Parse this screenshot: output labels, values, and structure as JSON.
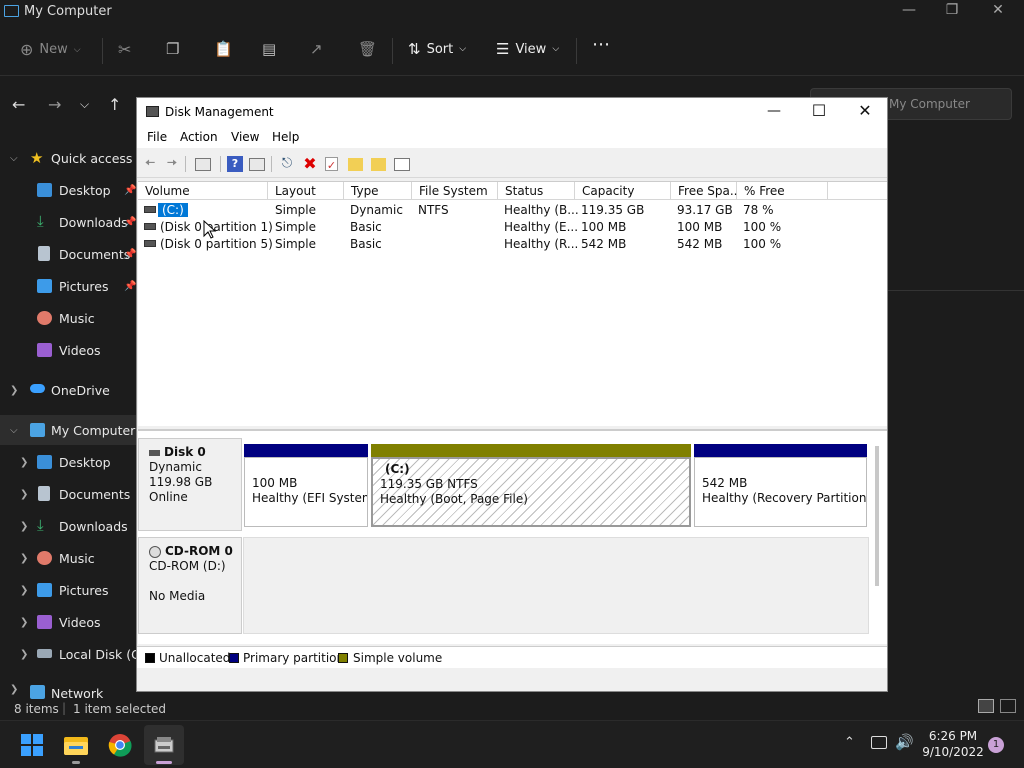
{
  "explorer": {
    "title": "My Computer",
    "commands": {
      "new": "New",
      "sort": "Sort",
      "view": "View"
    },
    "search_placeholder": "My Computer",
    "sidebar": [
      {
        "label": "Quick access",
        "icon": "star-icon"
      },
      {
        "label": "Desktop",
        "icon": "desktop-icon"
      },
      {
        "label": "Downloads",
        "icon": "download-icon"
      },
      {
        "label": "Documents",
        "icon": "document-icon"
      },
      {
        "label": "Pictures",
        "icon": "pictures-icon"
      },
      {
        "label": "Music",
        "icon": "music-icon"
      },
      {
        "label": "Videos",
        "icon": "videos-icon"
      },
      {
        "label": "OneDrive",
        "icon": "cloud-icon"
      },
      {
        "label": "My Computer",
        "icon": "computer-icon"
      },
      {
        "label": "Desktop",
        "icon": "desktop-icon"
      },
      {
        "label": "Documents",
        "icon": "document-icon"
      },
      {
        "label": "Downloads",
        "icon": "download-icon"
      },
      {
        "label": "Music",
        "icon": "music-icon"
      },
      {
        "label": "Pictures",
        "icon": "pictures-icon"
      },
      {
        "label": "Videos",
        "icon": "videos-icon"
      },
      {
        "label": "Local Disk (C:)",
        "icon": "drive-icon"
      },
      {
        "label": "Network",
        "icon": "network-icon"
      }
    ],
    "status": {
      "items": "8 items",
      "selected": "1 item selected"
    }
  },
  "dm": {
    "title": "Disk Management",
    "menu": [
      "File",
      "Action",
      "View",
      "Help"
    ],
    "columns": [
      "Volume",
      "Layout",
      "Type",
      "File System",
      "Status",
      "Capacity",
      "Free Spa...",
      "% Free"
    ],
    "rows": [
      [
        "(C:)",
        "Simple",
        "Dynamic",
        "NTFS",
        "Healthy (B...",
        "119.35 GB",
        "93.17 GB",
        "78 %"
      ],
      [
        "(Disk 0 partition 1)",
        "Simple",
        "Basic",
        "",
        "Healthy (E...",
        "100 MB",
        "100 MB",
        "100 %"
      ],
      [
        "(Disk 0 partition 5)",
        "Simple",
        "Basic",
        "",
        "Healthy (R...",
        "542 MB",
        "542 MB",
        "100 %"
      ]
    ],
    "disk0": {
      "name": "Disk 0",
      "type": "Dynamic",
      "size": "119.98 GB",
      "state": "Online"
    },
    "partitions": [
      {
        "l1": "100 MB",
        "l2": "Healthy (EFI System P"
      },
      {
        "l0": "(C:)",
        "l1": "119.35 GB NTFS",
        "l2": "Healthy (Boot, Page File)"
      },
      {
        "l1": "542 MB",
        "l2": "Healthy (Recovery Partition)"
      }
    ],
    "cdrom": {
      "name": "CD-ROM 0",
      "drive": "CD-ROM (D:)",
      "media": "No Media"
    },
    "legend": [
      {
        "label": "Unallocated",
        "color": "#000000"
      },
      {
        "label": "Primary partition",
        "color": "#000080"
      },
      {
        "label": "Simple volume",
        "color": "#808000"
      }
    ]
  },
  "taskbar": {
    "time": "6:26 PM",
    "date": "9/10/2022",
    "notifications": "1"
  }
}
